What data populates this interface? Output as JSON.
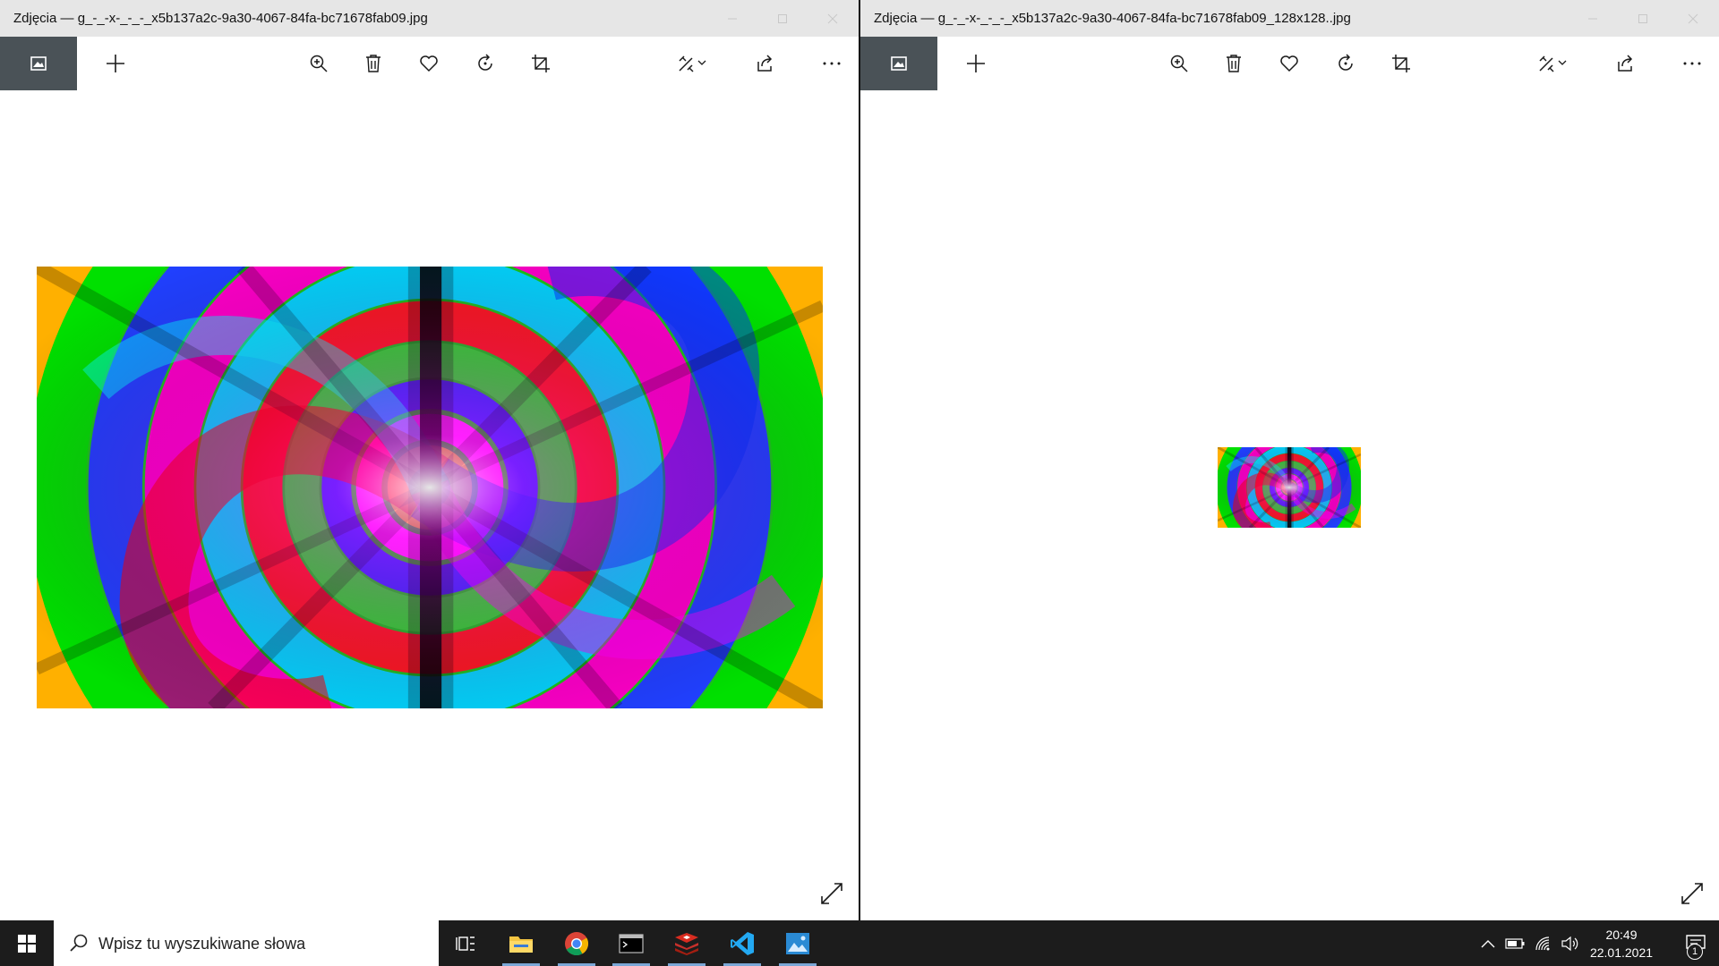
{
  "windows": {
    "left": {
      "title": "Zdjęcia — g_-_-x-_-_-_x5b137a2c-9a30-4067-84fa-bc71678fab09.jpg"
    },
    "right": {
      "title": "Zdjęcia — g_-_-x-_-_-_x5b137a2c-9a30-4067-84fa-bc71678fab09_128x128..jpg"
    }
  },
  "toolbar_icons": [
    "photos-home-icon",
    "add-icon",
    "zoom-in-icon",
    "delete-icon",
    "favorite-icon",
    "rotate-icon",
    "crop-icon",
    "edit-create-icon",
    "share-icon",
    "more-icon"
  ],
  "taskbar": {
    "search_placeholder": "Wpisz tu wyszukiwane słowa",
    "apps": [
      "task-view-icon",
      "file-explorer-icon",
      "chrome-icon",
      "terminal-icon",
      "redis-icon",
      "vscode-icon",
      "photos-icon"
    ],
    "time": "20:49",
    "date": "22.01.2021",
    "notification_count": "1"
  },
  "colors": {
    "titlebar": "#e6e6e6",
    "home_button": "#4a5257",
    "taskbar": "#1c1c1c",
    "running_indicator": "#7aa7d6"
  }
}
